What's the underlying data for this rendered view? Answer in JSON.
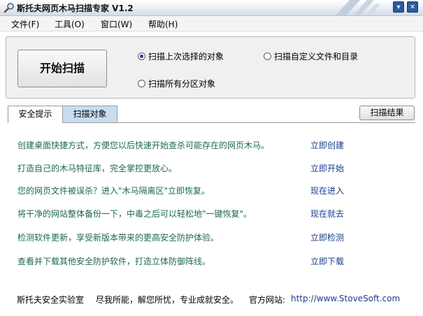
{
  "window": {
    "title": "斯托夫网页木马扫描专家 V1.2",
    "minimize_glyph": "▾",
    "close_glyph": "✕"
  },
  "menu": {
    "items": [
      "文件(F)",
      "工具(O)",
      "窗口(W)",
      "帮助(H)"
    ]
  },
  "scan_panel": {
    "start_button": "开始扫描",
    "options": [
      {
        "label": "扫描上次选择的对象",
        "selected": true
      },
      {
        "label": "扫描自定义文件和目录",
        "selected": false
      },
      {
        "label": "扫描所有分区对象",
        "selected": false
      }
    ]
  },
  "tabs": [
    {
      "label": "安全提示",
      "active": true
    },
    {
      "label": "扫描对象",
      "active": false
    }
  ],
  "result_button": "扫描结果",
  "tips": [
    {
      "text": "创建桌面快捷方式，方便您以后快速开始查杀可能存在的网页木马。",
      "action": "立即创建"
    },
    {
      "text": "打造自己的木马特征库，完全掌控更放心。",
      "action": "立即开始"
    },
    {
      "text": "您的网页文件被误杀？进入\"木马隔离区\"立即恢复。",
      "action": "现在进入"
    },
    {
      "text": "将干净的网站整体备份一下，中毒之后可以轻松地\"一键恢复\"。",
      "action": "现在就去"
    },
    {
      "text": "检测软件更新，享受新版本带来的更高安全防护体验。",
      "action": "立即检测"
    },
    {
      "text": "查看并下载其他安全防护软件，打造立体防御阵线。",
      "action": "立即下载"
    }
  ],
  "footer": {
    "lab": "斯托夫安全实验室",
    "slogan": "尽我所能，解您所忧，专业成就安全。",
    "site_label": "官方网站:",
    "url": "http://www.StoveSoft.com"
  },
  "colors": {
    "tip_text": "#1e6a48",
    "link": "#1a3f8a",
    "tab_inactive": "#c8ddf0"
  }
}
